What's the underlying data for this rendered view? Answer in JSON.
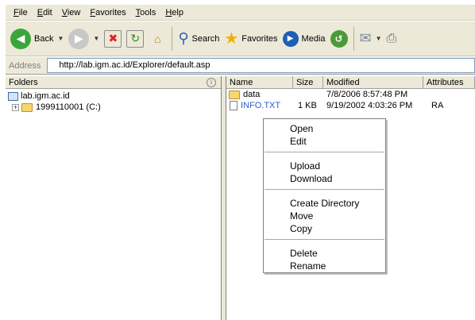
{
  "menu": [
    "File",
    "Edit",
    "View",
    "Favorites",
    "Tools",
    "Help"
  ],
  "toolbar": {
    "back_label": "Back",
    "search_label": "Search",
    "favorites_label": "Favorites",
    "media_label": "Media"
  },
  "address": {
    "label": "Address",
    "value": "http://lab.igm.ac.id/Explorer/default.asp"
  },
  "folders": {
    "title": "Folders",
    "root": "lab.igm.ac.id",
    "expander": "+",
    "drive": "1999110001 (C:)"
  },
  "files": {
    "columns": [
      "Name",
      "Size",
      "Modified",
      "Attributes"
    ],
    "rows": [
      {
        "name": "data",
        "size": "",
        "modified": "7/8/2006 8:57:48 PM",
        "attributes": ""
      },
      {
        "name": "INFO.TXT",
        "size": "1 KB",
        "modified": "9/19/2002 4:03:26 PM",
        "attributes": "RA"
      }
    ]
  },
  "context_menu": [
    [
      "Open",
      "Edit"
    ],
    [
      "Upload",
      "Download"
    ],
    [
      "Create Directory",
      "Move",
      "Copy"
    ],
    [
      "Delete",
      "Rename"
    ]
  ]
}
